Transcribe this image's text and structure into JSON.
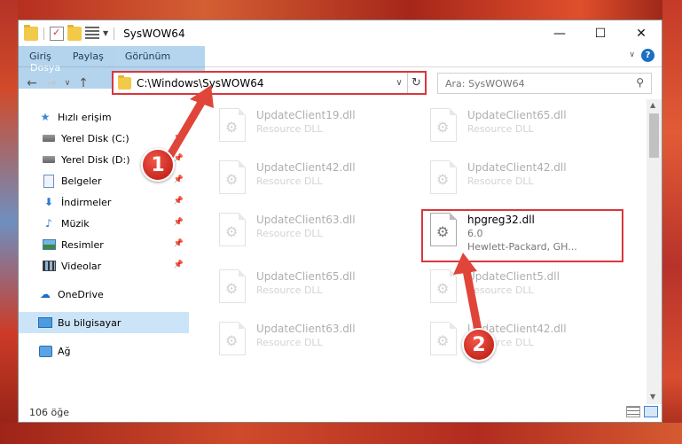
{
  "window": {
    "title": "SysWOW64",
    "controls": {
      "minimize": "—",
      "maximize": "☐",
      "close": "✕"
    }
  },
  "ribbon": {
    "tabs": [
      {
        "label": "Dosya",
        "active": true
      },
      {
        "label": "Giriş"
      },
      {
        "label": "Paylaş"
      },
      {
        "label": "Görünüm"
      }
    ]
  },
  "address": {
    "path": "C:\\Windows\\SysWOW64",
    "search_placeholder": "Ara: SysWOW64"
  },
  "nav": {
    "items": [
      {
        "label": "Hızlı erişim",
        "icon": "star-icon"
      },
      {
        "label": "Yerel Disk (C:)",
        "icon": "drive-icon",
        "pinned": true
      },
      {
        "label": "Yerel Disk (D:)",
        "icon": "drive-icon",
        "pinned": true
      },
      {
        "label": "Belgeler",
        "icon": "documents-icon",
        "pinned": true
      },
      {
        "label": "İndirmeler",
        "icon": "downloads-icon",
        "pinned": true
      },
      {
        "label": "Müzik",
        "icon": "music-icon",
        "pinned": true
      },
      {
        "label": "Resimler",
        "icon": "pictures-icon",
        "pinned": true
      },
      {
        "label": "Videolar",
        "icon": "videos-icon",
        "pinned": true
      },
      {
        "label": "OneDrive",
        "icon": "cloud-icon"
      },
      {
        "label": "Bu bilgisayar",
        "icon": "computer-icon",
        "selected": true
      },
      {
        "label": "Ağ",
        "icon": "network-icon"
      }
    ]
  },
  "files": [
    {
      "name": "UpdateClient19.dll",
      "desc": "Resource DLL"
    },
    {
      "name": "UpdateClient65.dll",
      "desc": "Resource DLL"
    },
    {
      "name": "UpdateClient42.dll",
      "desc": "Resource DLL"
    },
    {
      "name": "UpdateClient42.dll",
      "desc": "Resource DLL"
    },
    {
      "name": "UpdateClient63.dll",
      "desc": "Resource DLL"
    },
    {
      "name": "hpgreg32.dll",
      "desc": "6.0",
      "company": "Hewlett-Packard, GH...",
      "highlight": true
    },
    {
      "name": "UpdateClient65.dll",
      "desc": "Resource DLL"
    },
    {
      "name": "UpdateClient5.dll",
      "desc": "Resource DLL"
    },
    {
      "name": "UpdateClient63.dll",
      "desc": "Resource DLL"
    },
    {
      "name": "UpdateClient42.dll",
      "desc": "Resource DLL"
    }
  ],
  "status": {
    "count": "106 öğe"
  },
  "annotations": {
    "badge1": "1",
    "badge2": "2"
  },
  "colors": {
    "accent": "#1979ca",
    "highlight_red": "#d9363e",
    "selected_bg": "#cce4f7"
  }
}
